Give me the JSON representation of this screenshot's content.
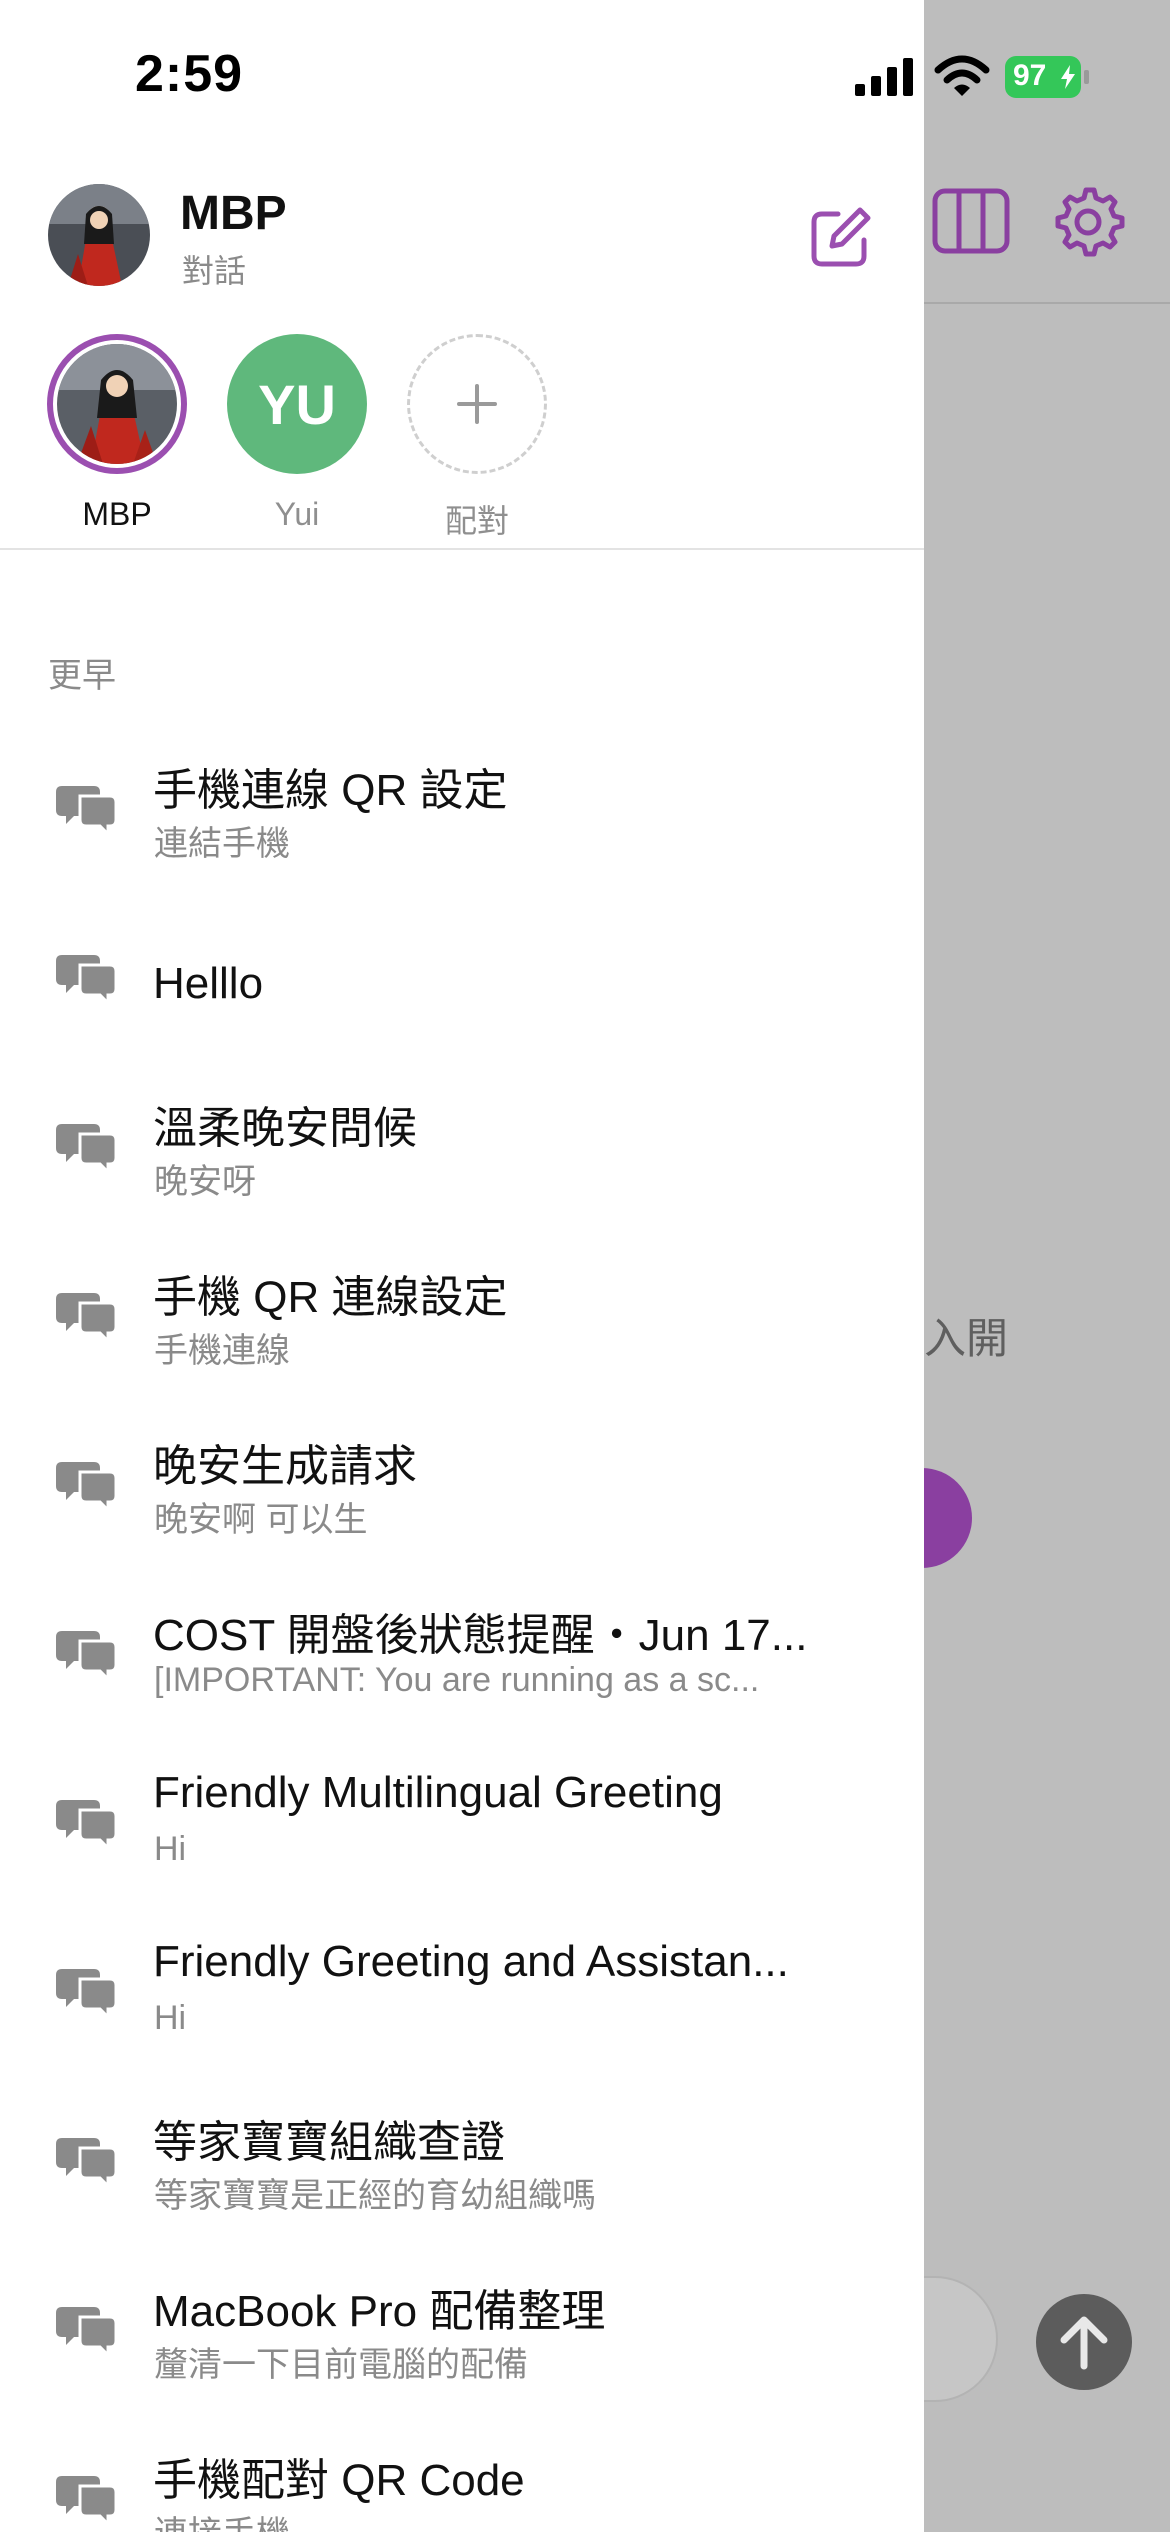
{
  "status_bar": {
    "time": "2:59",
    "battery": "97"
  },
  "header": {
    "title": "MBP",
    "subtitle": "對話"
  },
  "contacts": [
    {
      "label": "MBP"
    },
    {
      "label": "Yui",
      "initials": "YU"
    },
    {
      "label": "配對"
    }
  ],
  "section": {
    "label": "更早"
  },
  "conversations": [
    {
      "title": "手機連線 QR 設定",
      "subtitle": "連結手機"
    },
    {
      "title": "Helllo",
      "subtitle": ""
    },
    {
      "title": "溫柔晚安問候",
      "subtitle": "晚安呀"
    },
    {
      "title": "手機 QR 連線設定",
      "subtitle": "手機連線"
    },
    {
      "title": "晚安生成請求",
      "subtitle": "晚安啊 可以生"
    },
    {
      "title": "COST 開盤後狀態提醒・Jun 17...",
      "subtitle": "[IMPORTANT: You are running as a sc..."
    },
    {
      "title": "Friendly Multilingual Greeting",
      "subtitle": "Hi"
    },
    {
      "title": "Friendly Greeting and Assistan...",
      "subtitle": "Hi"
    },
    {
      "title": "等家寶寶組織查證",
      "subtitle": "等家寶寶是正經的育幼組織嗎"
    },
    {
      "title": "MacBook Pro 配備整理",
      "subtitle": "釐清一下目前電腦的配備"
    },
    {
      "title": "手機配對 QR Code",
      "subtitle": "連接手機"
    }
  ],
  "background": {
    "hint_text": "入開"
  },
  "colors": {
    "accent": "#9b4fb0",
    "yui_avatar": "#5fb87c",
    "battery": "#34c759",
    "overlay": "#bdbdbd"
  },
  "icons": [
    "compose-icon",
    "sidebar-toggle-icon",
    "settings-gear-icon",
    "chat-bubbles-icon",
    "plus-icon",
    "send-arrow-icon"
  ]
}
